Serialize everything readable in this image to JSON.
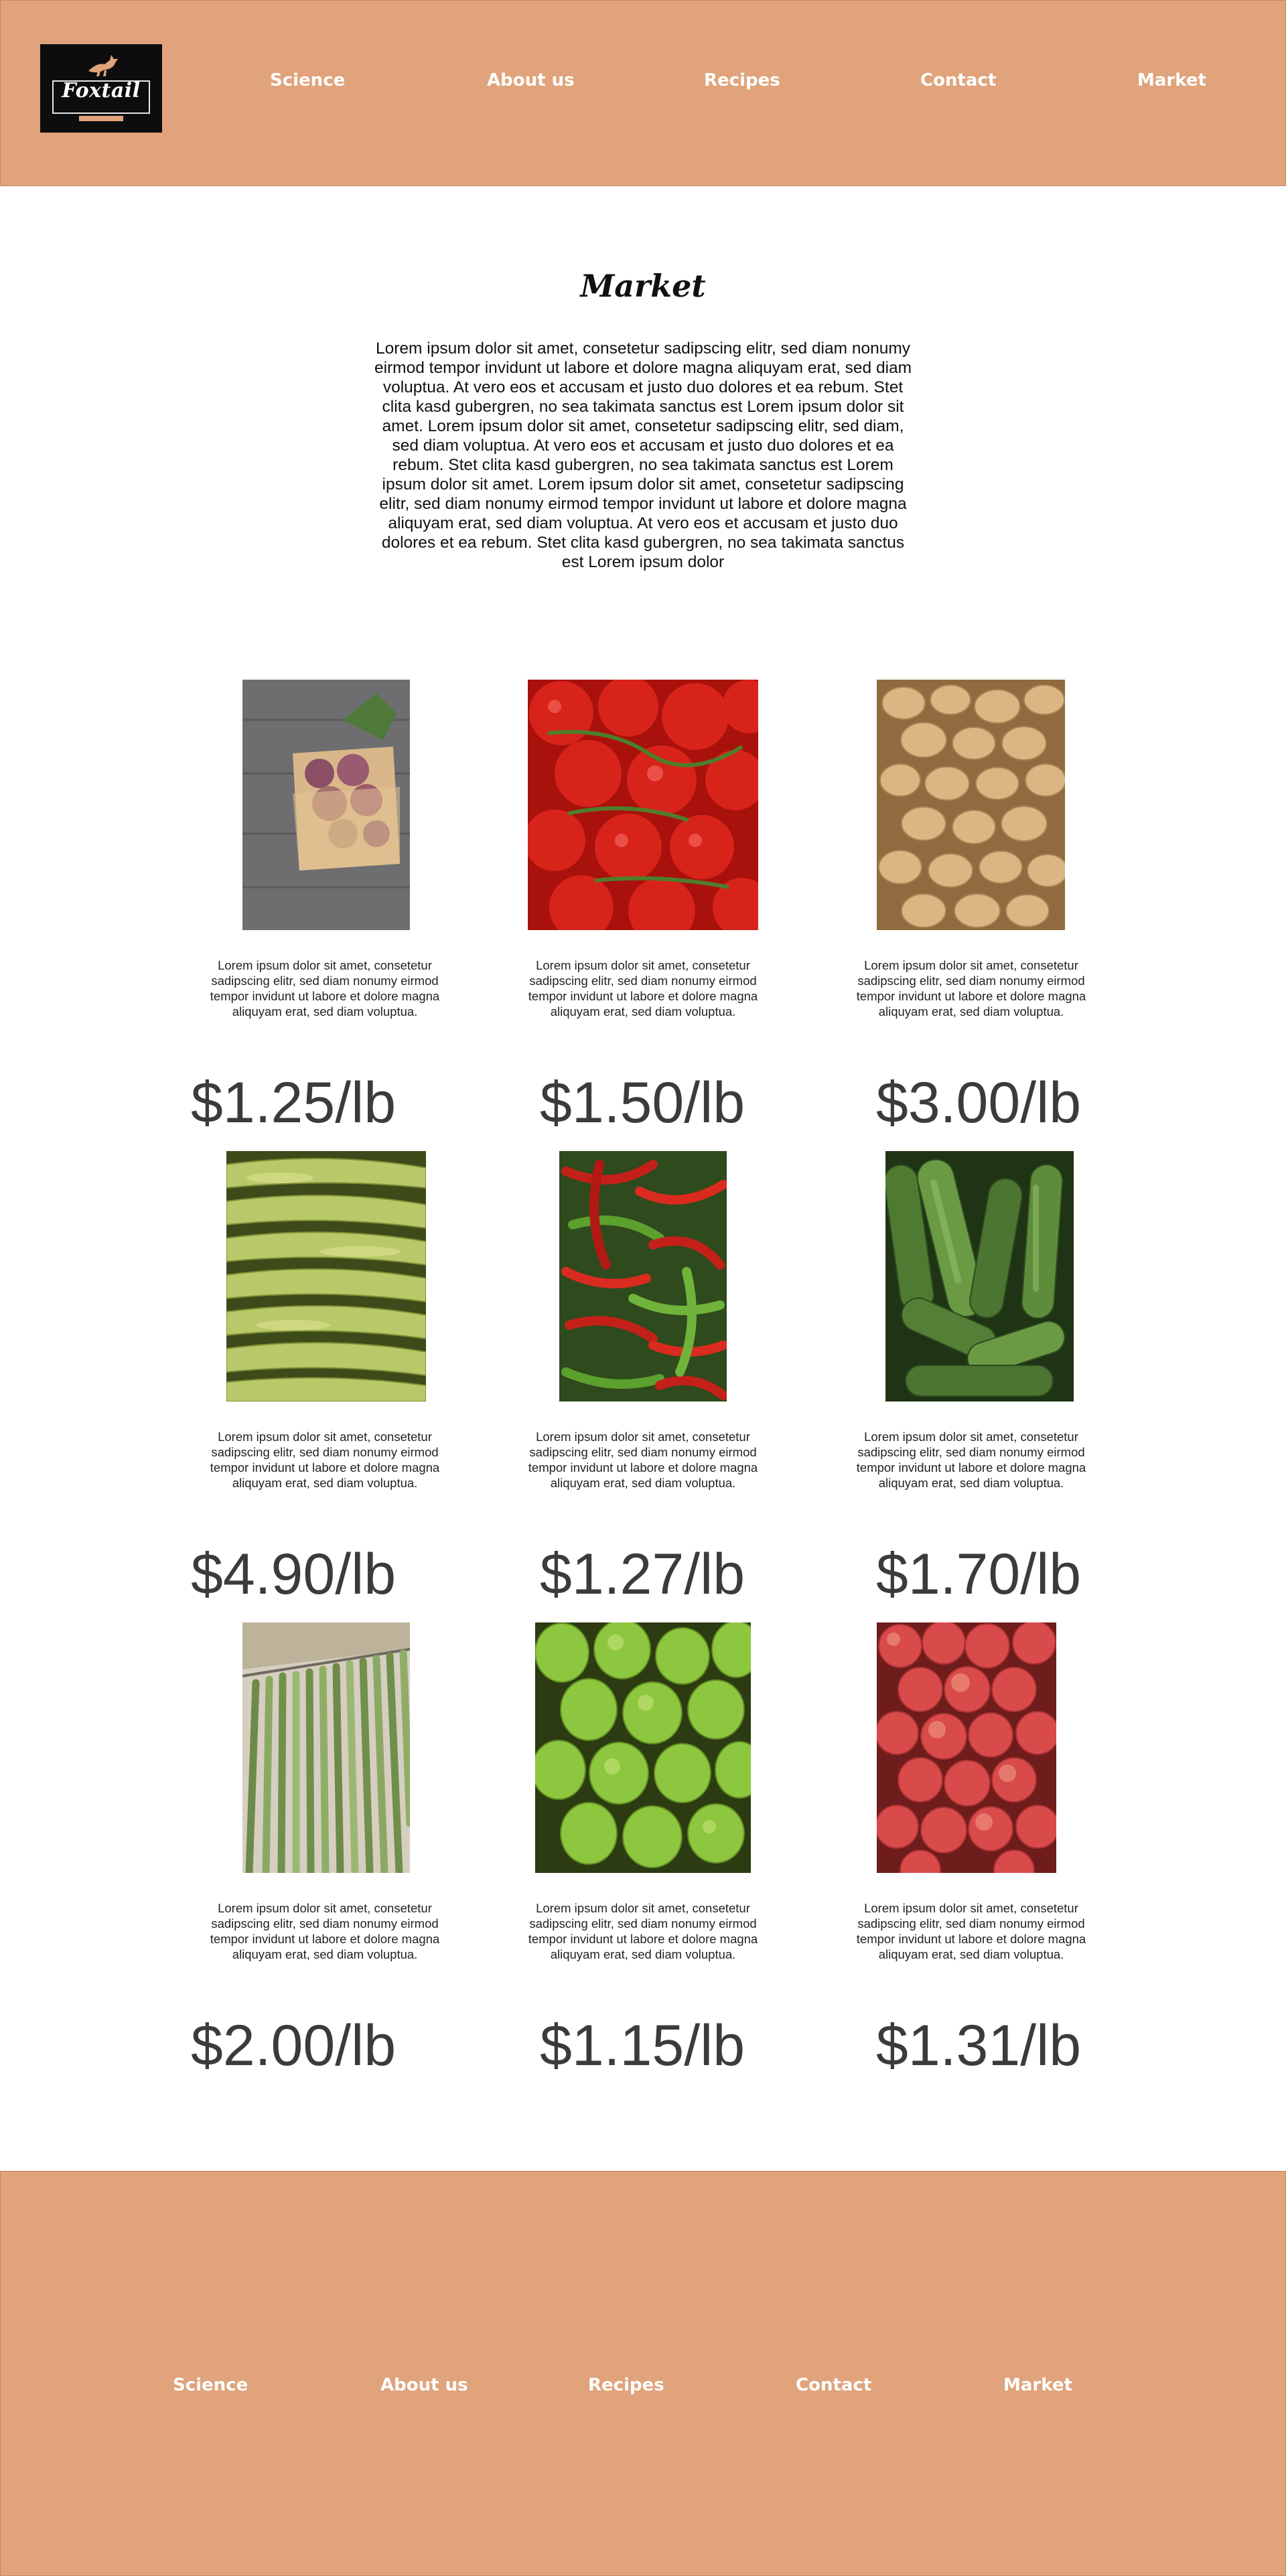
{
  "logo": {
    "text": "Foxtail"
  },
  "nav": [
    "Science",
    "About us",
    "Recipes",
    "Contact",
    "Market"
  ],
  "page": {
    "title": "Market",
    "intro": "Lorem ipsum dolor sit amet, consetetur sadipscing elitr, sed diam nonumy eirmod tempor invidunt ut labore et dolore magna aliquyam erat, sed diam voluptua. At vero eos et accusam et justo duo dolores et ea rebum. Stet clita kasd gubergren, no sea takimata sanctus est Lorem ipsum dolor sit amet. Lorem ipsum dolor sit amet, consetetur sadipscing elitr, sed diam, sed diam voluptua. At vero eos et accusam et justo duo dolores et ea rebum. Stet clita kasd gubergren, no sea takimata sanctus est Lorem ipsum dolor sit amet. Lorem ipsum dolor sit amet, consetetur sadipscing elitr, sed diam nonumy eirmod tempor invidunt ut labore et dolore magna aliquyam erat, sed diam voluptua. At vero eos et accusam et justo duo dolores et ea rebum. Stet clita kasd gubergren, no sea takimata sanctus est Lorem ipsum dolor"
  },
  "products": [
    {
      "image": "onions-basket-photo",
      "description": "Lorem ipsum dolor sit amet, consetetur sadipscing elitr, sed diam nonumy eirmod tempor invidunt ut labore et dolore magna aliquyam erat, sed diam voluptua.",
      "price": "$1.25/lb"
    },
    {
      "image": "tomatoes-photo",
      "description": "Lorem ipsum dolor sit amet, consetetur sadipscing elitr, sed diam nonumy eirmod tempor invidunt ut labore et dolore magna aliquyam erat, sed diam voluptua.",
      "price": "$1.50/lb"
    },
    {
      "image": "potatoes-photo",
      "description": "Lorem ipsum dolor sit amet, consetetur sadipscing elitr, sed diam nonumy eirmod tempor invidunt ut labore et dolore magna aliquyam erat, sed diam voluptua.",
      "price": "$3.00/lb"
    },
    {
      "image": "corn-photo",
      "description": "Lorem ipsum dolor sit amet, consetetur sadipscing elitr, sed diam nonumy eirmod tempor invidunt ut labore et dolore magna aliquyam erat, sed diam voluptua.",
      "price": "$4.90/lb"
    },
    {
      "image": "chili-peppers-photo",
      "description": "Lorem ipsum dolor sit amet, consetetur sadipscing elitr, sed diam nonumy eirmod tempor invidunt ut labore et dolore magna aliquyam erat, sed diam voluptua.",
      "price": "$1.27/lb"
    },
    {
      "image": "cucumbers-photo",
      "description": "Lorem ipsum dolor sit amet, consetetur sadipscing elitr, sed diam nonumy eirmod tempor invidunt ut labore et dolore magna aliquyam erat, sed diam voluptua.",
      "price": "$1.70/lb"
    },
    {
      "image": "asparagus-photo",
      "description": "Lorem ipsum dolor sit amet, consetetur sadipscing elitr, sed diam nonumy eirmod tempor invidunt ut labore et dolore magna aliquyam erat, sed diam voluptua.",
      "price": "$2.00/lb"
    },
    {
      "image": "pears-photo",
      "description": "Lorem ipsum dolor sit amet, consetetur sadipscing elitr, sed diam nonumy eirmod tempor invidunt ut labore et dolore magna aliquyam erat, sed diam voluptua.",
      "price": "$1.15/lb"
    },
    {
      "image": "apples-photo",
      "description": "Lorem ipsum dolor sit amet, consetetur sadipscing elitr, sed diam nonumy eirmod tempor invidunt ut labore et dolore magna aliquyam erat, sed diam voluptua.",
      "price": "$1.31/lb"
    }
  ],
  "footer": {
    "nav": [
      "Science",
      "About us",
      "Recipes",
      "Contact",
      "Market"
    ]
  },
  "colors": {
    "accent": "#e0a37b",
    "text": "#111111",
    "price": "#3b3b3b"
  }
}
